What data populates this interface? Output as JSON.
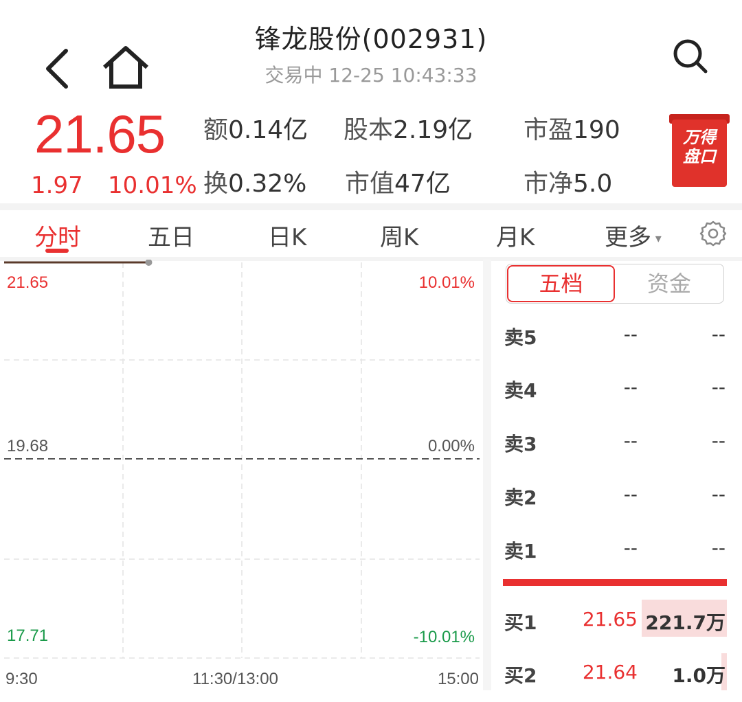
{
  "header": {
    "title": "锋龙股份(002931)",
    "subtitle": "交易中 12-25 10:43:33"
  },
  "quote": {
    "price": "21.65",
    "change": "1.97",
    "change_pct": "10.01%",
    "stats": [
      {
        "key": "额",
        "value": "0.14亿"
      },
      {
        "key": "股本",
        "value": "2.19亿"
      },
      {
        "key": "市盈",
        "value": "190"
      },
      {
        "key": "换",
        "value": "0.32%"
      },
      {
        "key": "市值",
        "value": "47亿"
      },
      {
        "key": "市净",
        "value": "5.0"
      }
    ],
    "badge_text": "万得盘口"
  },
  "tabs": [
    {
      "label": "分时",
      "active": true
    },
    {
      "label": "五日"
    },
    {
      "label": "日K"
    },
    {
      "label": "周K"
    },
    {
      "label": "月K"
    },
    {
      "label": "更多"
    }
  ],
  "chart": {
    "price_top": "21.65",
    "price_mid": "19.68",
    "price_bottom": "17.71",
    "pct_top": "10.01%",
    "pct_mid": "0.00%",
    "pct_bottom": "-10.01%",
    "time_start": "9:30",
    "time_mid": "11:30/13:00",
    "time_end": "15:00"
  },
  "chart_data": {
    "type": "line",
    "x": [
      "9:30",
      "10:43"
    ],
    "series": [
      {
        "values": [
          21.65,
          21.65
        ]
      }
    ],
    "ylim": [
      17.71,
      21.65
    ],
    "xlabel": "",
    "ylabel": "",
    "grid": true
  },
  "orderbook": {
    "seg_active": "五档",
    "seg_other": "资金",
    "rows": [
      {
        "label": "卖5",
        "price": "--",
        "vol": "--"
      },
      {
        "label": "卖4",
        "price": "--",
        "vol": "--"
      },
      {
        "label": "卖3",
        "price": "--",
        "vol": "--"
      },
      {
        "label": "卖2",
        "price": "--",
        "vol": "--"
      },
      {
        "label": "卖1",
        "price": "--",
        "vol": "--"
      },
      {
        "label": "买1",
        "price": "21.65",
        "vol": "221.7万"
      },
      {
        "label": "买2",
        "price": "21.64",
        "vol": "1.0万"
      }
    ]
  },
  "colors": {
    "up": "#e93030",
    "down": "#1a9a4a",
    "accent": "#e93030"
  }
}
